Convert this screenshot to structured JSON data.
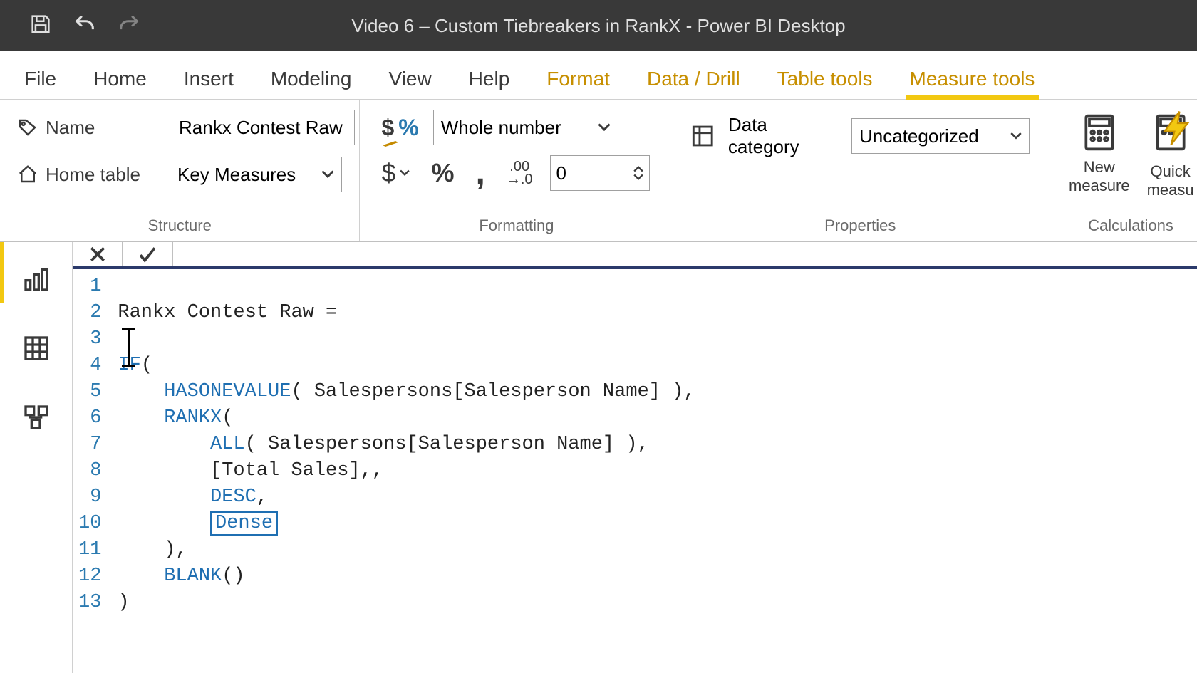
{
  "app": {
    "title": "Video 6 – Custom Tiebreakers in RankX - Power BI Desktop"
  },
  "ribbon": {
    "tabs": [
      "File",
      "Home",
      "Insert",
      "Modeling",
      "View",
      "Help",
      "Format",
      "Data / Drill",
      "Table tools",
      "Measure tools"
    ],
    "active_tab": "Measure tools"
  },
  "structure": {
    "name_label": "Name",
    "name_value": "Rankx Contest Raw",
    "home_table_label": "Home table",
    "home_table_value": "Key Measures",
    "group_label": "Structure"
  },
  "formatting": {
    "format_value": "Whole number",
    "decimals_value": "0",
    "group_label": "Formatting"
  },
  "properties": {
    "category_label": "Data category",
    "category_value": "Uncategorized",
    "group_label": "Properties"
  },
  "calculations": {
    "new_measure": "New\nmeasure",
    "quick_measure": "Quick\nmeasu",
    "group_label": "Calculations"
  },
  "formula": {
    "lines": {
      "l1": "Rankx Contest Raw =",
      "l3_kw": "IF",
      "l3_rest": "(",
      "l4_kw": "HASONEVALUE",
      "l4_rest": "( Salespersons[Salesperson Name] ),",
      "l5_kw": "RANKX",
      "l5_rest": "(",
      "l6_kw": "ALL",
      "l6_rest": "( Salespersons[Salesperson Name] ),",
      "l7": "[Total Sales],,",
      "l8_kw": "DESC",
      "l8_rest": ",",
      "l9_kw": "Dense",
      "l10": "),",
      "l11_kw": "BLANK",
      "l11_rest": "()",
      "l12": ")"
    }
  }
}
